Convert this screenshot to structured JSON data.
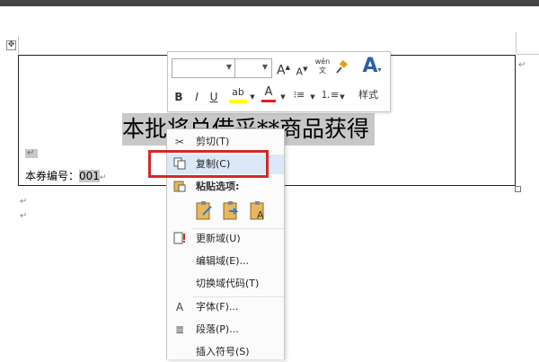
{
  "document": {
    "title_text": "本批将兑借采**商品获得",
    "ticket_label": "本券编号：",
    "ticket_number": "001",
    "paragraph_mark": "↵"
  },
  "mini_toolbar": {
    "font_name": "",
    "font_size": "",
    "grow_font": "A",
    "shrink_font": "A",
    "phonetic_guide": "wén\n文",
    "bold": "B",
    "italic": "I",
    "underline": "U",
    "highlight": "ab",
    "font_color": "A",
    "styles_label": "样式"
  },
  "context_menu": {
    "items": [
      {
        "label": "剪切(T)",
        "icon": "scissors-icon"
      },
      {
        "label": "复制(C)",
        "icon": "copy-icon",
        "highlighted": true
      },
      {
        "label": "粘贴选项:",
        "icon": "paste-icon",
        "header": true
      },
      {
        "label": "更新域(U)",
        "icon": "update-field-icon"
      },
      {
        "label": "编辑域(E)...",
        "icon": ""
      },
      {
        "label": "切换域代码(T)",
        "icon": ""
      },
      {
        "label": "字体(F)...",
        "icon": "font-icon"
      },
      {
        "label": "段落(P)...",
        "icon": "paragraph-icon"
      },
      {
        "label": "插入符号(S)",
        "icon": ""
      }
    ]
  },
  "colors": {
    "highlight_yellow": "#ffff00",
    "font_color_red": "#e02020",
    "annotation_red": "#d12b2b",
    "selection_gray": "#c8c8c8",
    "hover_blue": "#dbe8f7"
  }
}
